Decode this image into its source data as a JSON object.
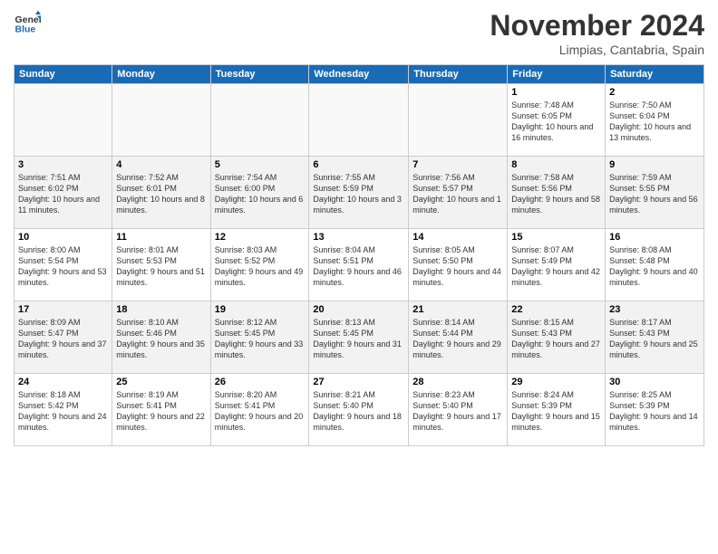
{
  "header": {
    "logo_line1": "General",
    "logo_line2": "Blue",
    "month_title": "November 2024",
    "location": "Limpias, Cantabria, Spain"
  },
  "weekdays": [
    "Sunday",
    "Monday",
    "Tuesday",
    "Wednesday",
    "Thursday",
    "Friday",
    "Saturday"
  ],
  "weeks": [
    [
      {
        "day": "",
        "info": ""
      },
      {
        "day": "",
        "info": ""
      },
      {
        "day": "",
        "info": ""
      },
      {
        "day": "",
        "info": ""
      },
      {
        "day": "",
        "info": ""
      },
      {
        "day": "1",
        "info": "Sunrise: 7:48 AM\nSunset: 6:05 PM\nDaylight: 10 hours and 16 minutes."
      },
      {
        "day": "2",
        "info": "Sunrise: 7:50 AM\nSunset: 6:04 PM\nDaylight: 10 hours and 13 minutes."
      }
    ],
    [
      {
        "day": "3",
        "info": "Sunrise: 7:51 AM\nSunset: 6:02 PM\nDaylight: 10 hours and 11 minutes."
      },
      {
        "day": "4",
        "info": "Sunrise: 7:52 AM\nSunset: 6:01 PM\nDaylight: 10 hours and 8 minutes."
      },
      {
        "day": "5",
        "info": "Sunrise: 7:54 AM\nSunset: 6:00 PM\nDaylight: 10 hours and 6 minutes."
      },
      {
        "day": "6",
        "info": "Sunrise: 7:55 AM\nSunset: 5:59 PM\nDaylight: 10 hours and 3 minutes."
      },
      {
        "day": "7",
        "info": "Sunrise: 7:56 AM\nSunset: 5:57 PM\nDaylight: 10 hours and 1 minute."
      },
      {
        "day": "8",
        "info": "Sunrise: 7:58 AM\nSunset: 5:56 PM\nDaylight: 9 hours and 58 minutes."
      },
      {
        "day": "9",
        "info": "Sunrise: 7:59 AM\nSunset: 5:55 PM\nDaylight: 9 hours and 56 minutes."
      }
    ],
    [
      {
        "day": "10",
        "info": "Sunrise: 8:00 AM\nSunset: 5:54 PM\nDaylight: 9 hours and 53 minutes."
      },
      {
        "day": "11",
        "info": "Sunrise: 8:01 AM\nSunset: 5:53 PM\nDaylight: 9 hours and 51 minutes."
      },
      {
        "day": "12",
        "info": "Sunrise: 8:03 AM\nSunset: 5:52 PM\nDaylight: 9 hours and 49 minutes."
      },
      {
        "day": "13",
        "info": "Sunrise: 8:04 AM\nSunset: 5:51 PM\nDaylight: 9 hours and 46 minutes."
      },
      {
        "day": "14",
        "info": "Sunrise: 8:05 AM\nSunset: 5:50 PM\nDaylight: 9 hours and 44 minutes."
      },
      {
        "day": "15",
        "info": "Sunrise: 8:07 AM\nSunset: 5:49 PM\nDaylight: 9 hours and 42 minutes."
      },
      {
        "day": "16",
        "info": "Sunrise: 8:08 AM\nSunset: 5:48 PM\nDaylight: 9 hours and 40 minutes."
      }
    ],
    [
      {
        "day": "17",
        "info": "Sunrise: 8:09 AM\nSunset: 5:47 PM\nDaylight: 9 hours and 37 minutes."
      },
      {
        "day": "18",
        "info": "Sunrise: 8:10 AM\nSunset: 5:46 PM\nDaylight: 9 hours and 35 minutes."
      },
      {
        "day": "19",
        "info": "Sunrise: 8:12 AM\nSunset: 5:45 PM\nDaylight: 9 hours and 33 minutes."
      },
      {
        "day": "20",
        "info": "Sunrise: 8:13 AM\nSunset: 5:45 PM\nDaylight: 9 hours and 31 minutes."
      },
      {
        "day": "21",
        "info": "Sunrise: 8:14 AM\nSunset: 5:44 PM\nDaylight: 9 hours and 29 minutes."
      },
      {
        "day": "22",
        "info": "Sunrise: 8:15 AM\nSunset: 5:43 PM\nDaylight: 9 hours and 27 minutes."
      },
      {
        "day": "23",
        "info": "Sunrise: 8:17 AM\nSunset: 5:43 PM\nDaylight: 9 hours and 25 minutes."
      }
    ],
    [
      {
        "day": "24",
        "info": "Sunrise: 8:18 AM\nSunset: 5:42 PM\nDaylight: 9 hours and 24 minutes."
      },
      {
        "day": "25",
        "info": "Sunrise: 8:19 AM\nSunset: 5:41 PM\nDaylight: 9 hours and 22 minutes."
      },
      {
        "day": "26",
        "info": "Sunrise: 8:20 AM\nSunset: 5:41 PM\nDaylight: 9 hours and 20 minutes."
      },
      {
        "day": "27",
        "info": "Sunrise: 8:21 AM\nSunset: 5:40 PM\nDaylight: 9 hours and 18 minutes."
      },
      {
        "day": "28",
        "info": "Sunrise: 8:23 AM\nSunset: 5:40 PM\nDaylight: 9 hours and 17 minutes."
      },
      {
        "day": "29",
        "info": "Sunrise: 8:24 AM\nSunset: 5:39 PM\nDaylight: 9 hours and 15 minutes."
      },
      {
        "day": "30",
        "info": "Sunrise: 8:25 AM\nSunset: 5:39 PM\nDaylight: 9 hours and 14 minutes."
      }
    ]
  ]
}
